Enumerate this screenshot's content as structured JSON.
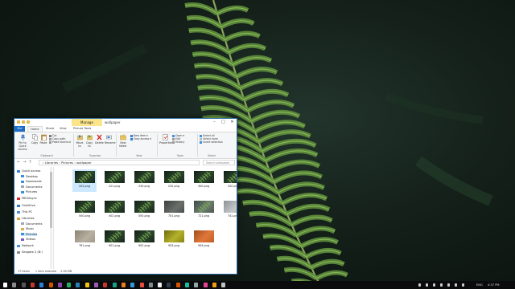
{
  "window": {
    "title": "wallpaper",
    "manage_tab": "Manage",
    "tabs": [
      "File",
      "Home",
      "Share",
      "View",
      "Picture Tools"
    ]
  },
  "ribbon": {
    "clipboard": {
      "pin": "Pin to Quick access",
      "copy": "Copy",
      "paste": "Paste",
      "cut": "Cut",
      "copy_path": "Copy path",
      "paste_shortcut": "Paste shortcut",
      "label": "Clipboard"
    },
    "organize": {
      "move_to": "Move to",
      "copy_to": "Copy to",
      "delete": "Delete",
      "rename": "Rename",
      "label": "Organize"
    },
    "new": {
      "new_folder": "New folder",
      "new_item": "New item",
      "easy_access": "Easy access",
      "label": "New"
    },
    "open": {
      "properties": "Properties",
      "open": "Open",
      "edit": "Edit",
      "history": "History",
      "label": "Open"
    },
    "select": {
      "select_all": "Select all",
      "select_none": "Select none",
      "invert": "Invert selection",
      "label": "Select"
    }
  },
  "address": {
    "crumbs": [
      "Libraries",
      "Pictures",
      "wallpaper"
    ],
    "search_placeholder": "Search wallpaper"
  },
  "nav_pane": [
    {
      "label": "Quick access",
      "color": "#2f7fd8"
    },
    {
      "label": "Desktop",
      "color": "#3b8ee0"
    },
    {
      "label": "Downloads",
      "color": "#3b8ee0"
    },
    {
      "label": "Documents",
      "color": "#9aa7b4"
    },
    {
      "label": "Pictures",
      "color": "#3b8ee0"
    },
    {
      "label": "MEGAsync",
      "color": "#d9272e"
    },
    {
      "label": "OneDrive",
      "color": "#2a7bd1"
    },
    {
      "label": "This PC",
      "color": "#4a90d9"
    },
    {
      "label": "Libraries",
      "color": "#d9a43b"
    },
    {
      "label": "Documents",
      "color": "#9aa7b4"
    },
    {
      "label": "Music",
      "color": "#e0a94a"
    },
    {
      "label": "Pictures",
      "color": "#3b8ee0"
    },
    {
      "label": "Videos",
      "color": "#7a58c4"
    },
    {
      "label": "Network",
      "color": "#4a90d9"
    },
    {
      "label": "Seagate 2 (B:)",
      "color": "#888888"
    }
  ],
  "files": [
    {
      "name": "202.png",
      "style": "fern",
      "selected": true
    },
    {
      "name": "221.png",
      "style": "fern"
    },
    {
      "name": "230.png",
      "style": "fern"
    },
    {
      "name": "232.png",
      "style": "fern"
    },
    {
      "name": "300.png",
      "style": "fern"
    },
    {
      "name": "320.png",
      "style": "fern"
    },
    {
      "name": "500.png",
      "style": "fern"
    },
    {
      "name": "502.png",
      "style": "fern"
    },
    {
      "name": "550.png",
      "style": "fern"
    },
    {
      "name": "701.png",
      "style": "gray"
    },
    {
      "name": "721.png",
      "style": "grayfern"
    },
    {
      "name": "741.png",
      "style": "lightgray"
    },
    {
      "name": "761.png",
      "style": "beige"
    },
    {
      "name": "901.png",
      "style": "fern"
    },
    {
      "name": "902.png",
      "style": "fern"
    },
    {
      "name": "903.png",
      "style": "yellow"
    },
    {
      "name": "904.png",
      "style": "orange"
    }
  ],
  "status": {
    "count": "17 items",
    "selected": "1 item selected",
    "size": "2.94 MB"
  },
  "tray": {
    "lang": "ENG",
    "time": "4:37 PM"
  }
}
